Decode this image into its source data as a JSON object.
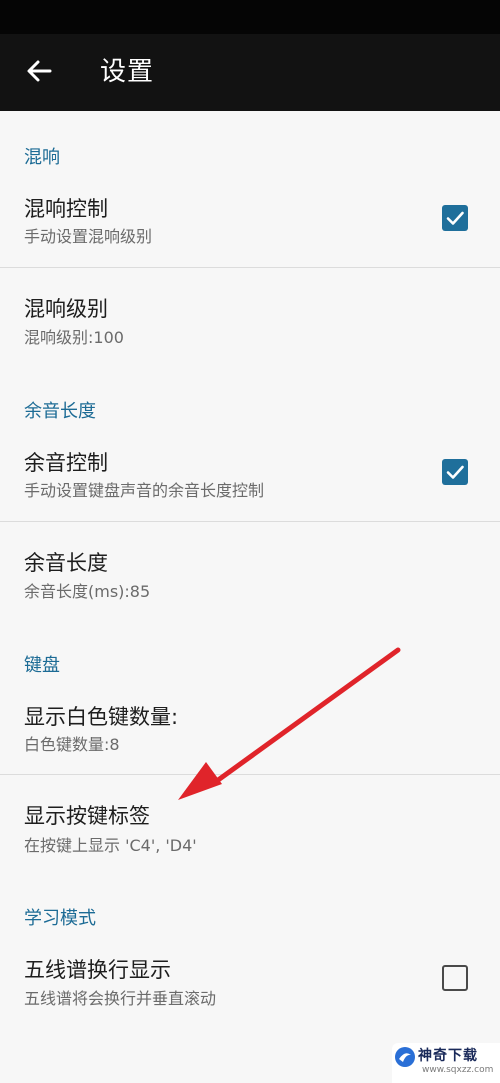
{
  "app_bar": {
    "title": "设置",
    "back_icon": "arrow-left-icon"
  },
  "sections": [
    {
      "header": "混响",
      "items": [
        {
          "title": "混响控制",
          "summary": "手动设置混响级别",
          "checkbox": true
        },
        {
          "title": "混响级别",
          "summary": "混响级别:100"
        }
      ]
    },
    {
      "header": "余音长度",
      "items": [
        {
          "title": "余音控制",
          "summary": "手动设置键盘声音的余音长度控制",
          "checkbox": true
        },
        {
          "title": "余音长度",
          "summary": "余音长度(ms):85"
        }
      ]
    },
    {
      "header": "键盘",
      "items": [
        {
          "title": "显示白色键数量:",
          "summary": "白色键数量:8"
        },
        {
          "title": "显示按键标签",
          "summary": "在按键上显示 'C4', 'D4'"
        }
      ]
    },
    {
      "header": "学习模式",
      "items": [
        {
          "title": "五线谱换行显示",
          "summary": "五线谱将会换行并垂直滚动",
          "checkbox": false
        }
      ]
    }
  ],
  "colors": {
    "accent": "#1f6f9b",
    "section_header": "#1c6b95",
    "app_bar": "#121212",
    "background": "#f7f7f7",
    "annotation_arrow": "#e0242a"
  },
  "watermark": {
    "brand": "神奇下载",
    "url": "www.sqxzz.com"
  }
}
